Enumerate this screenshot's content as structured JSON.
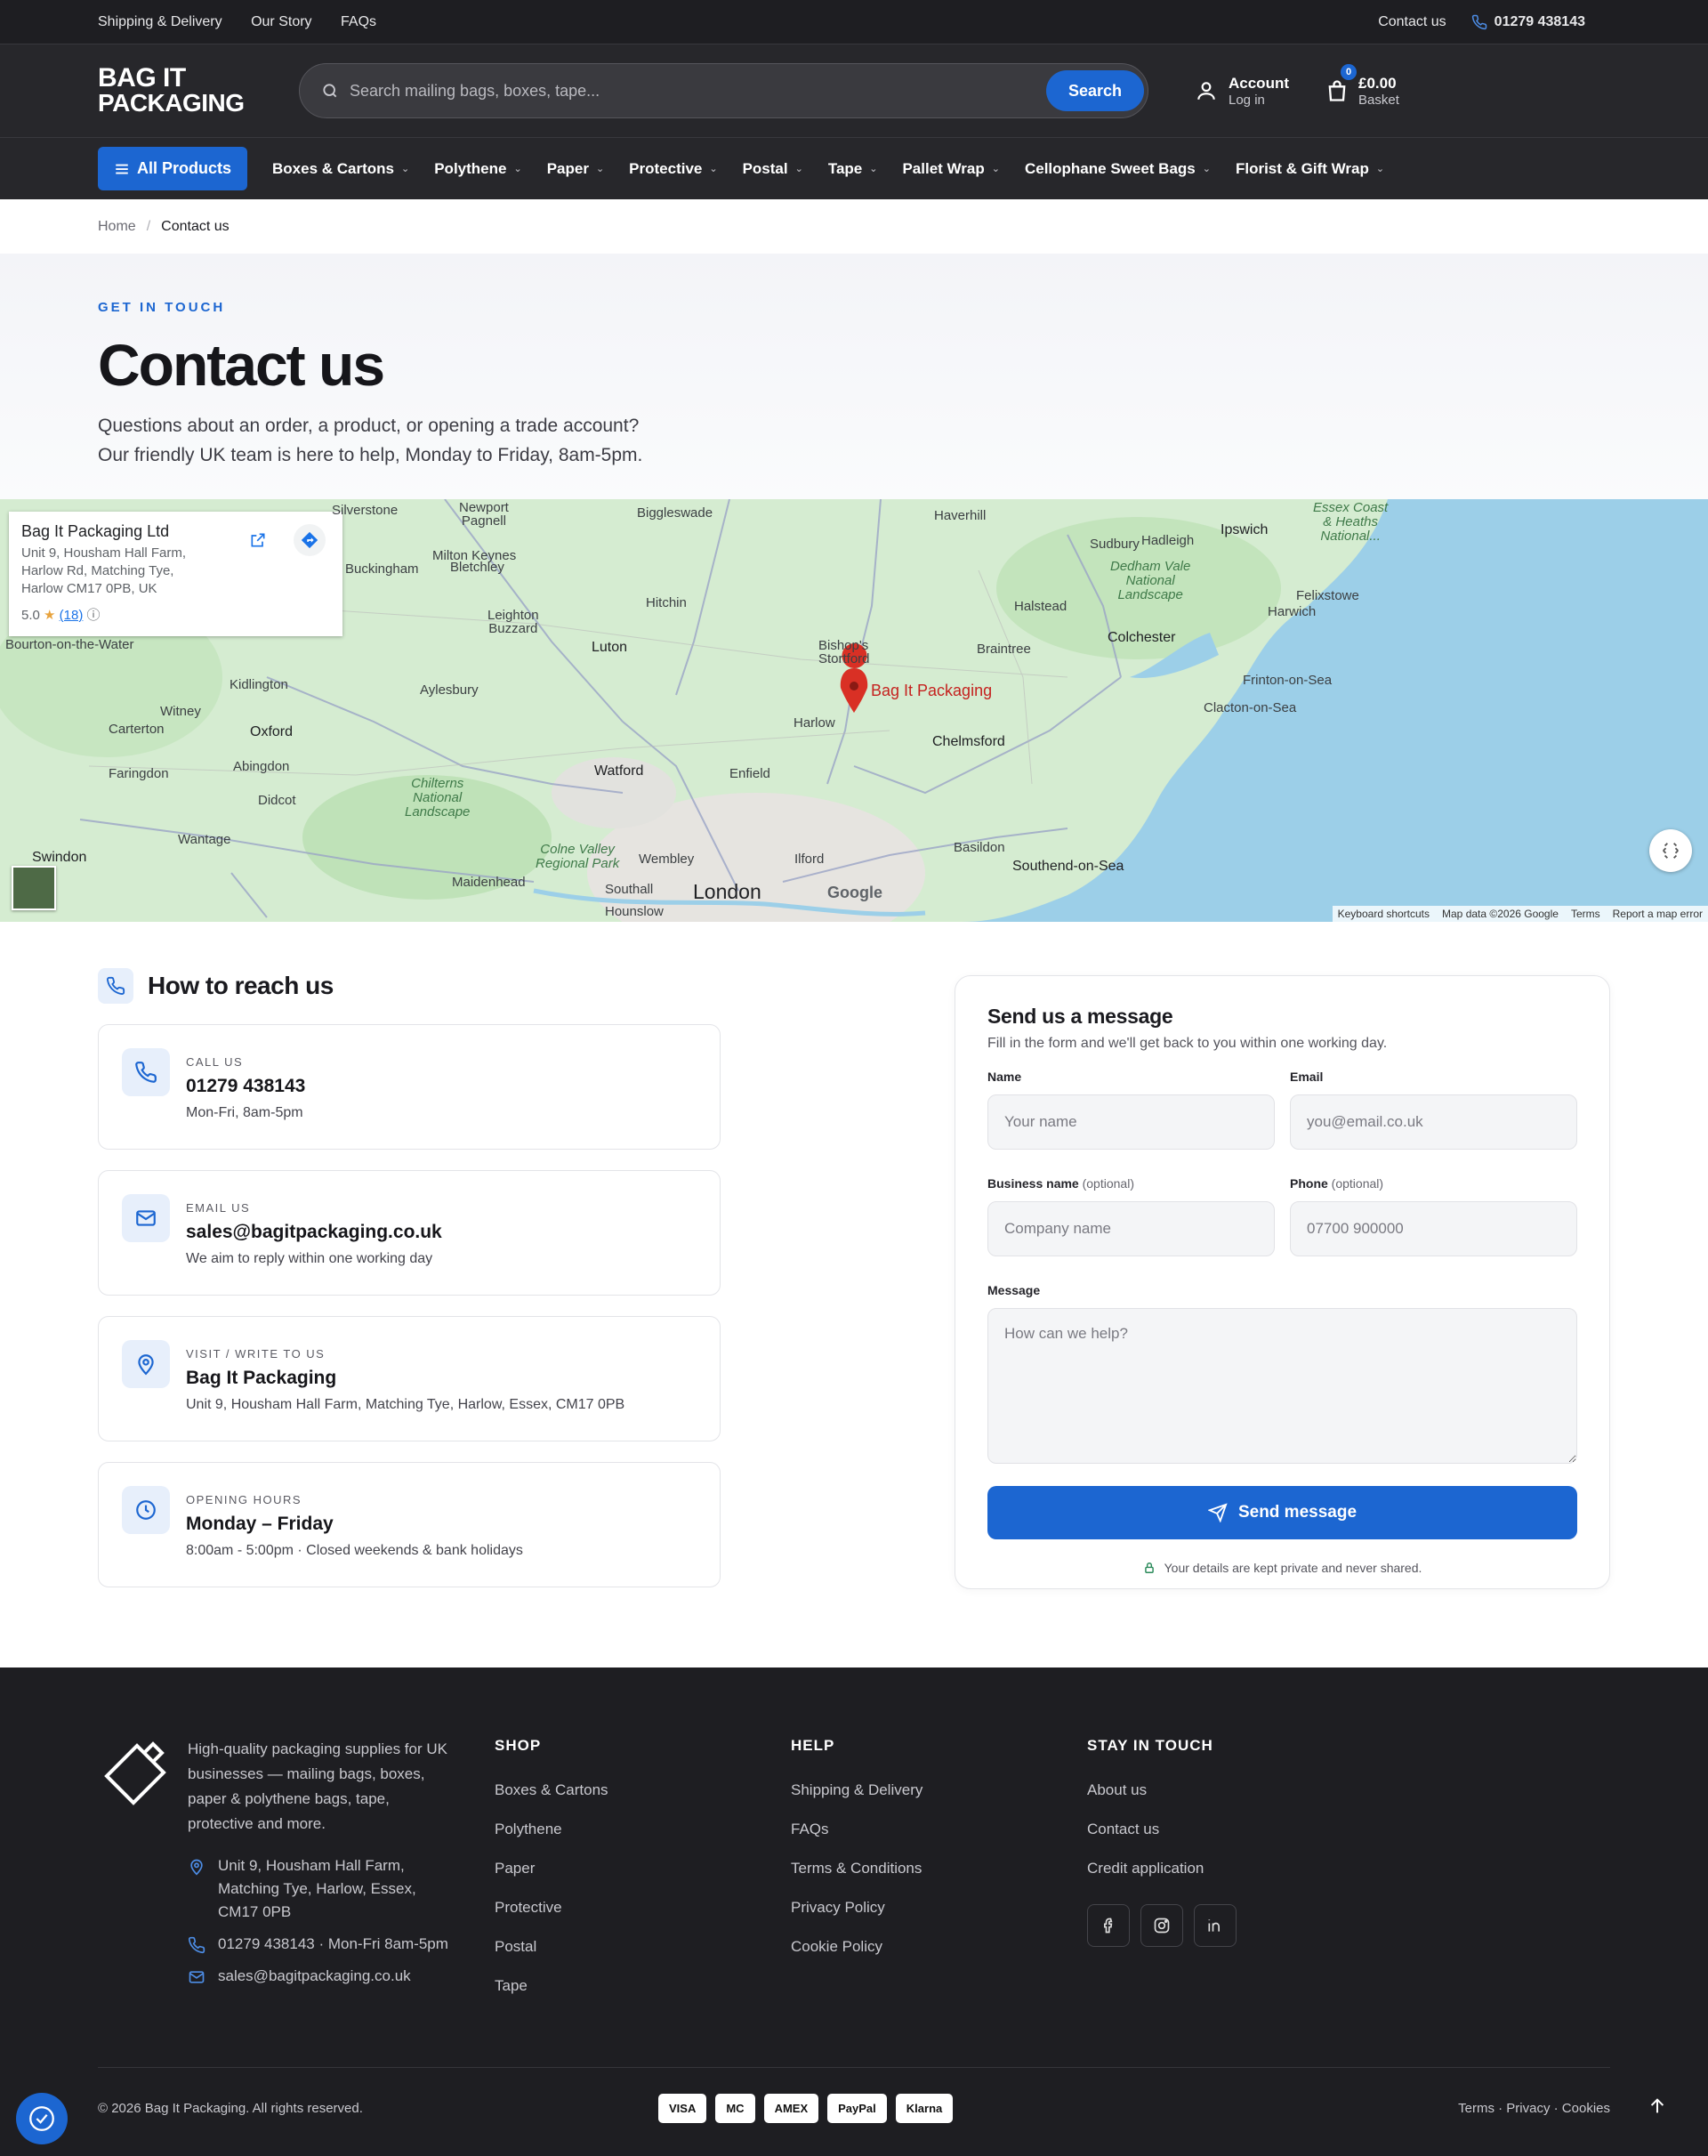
{
  "topbar": {
    "links": [
      "Shipping & Delivery",
      "Our Story",
      "FAQs"
    ],
    "contact_label": "Contact us",
    "phone": "01279 438143"
  },
  "header": {
    "logo_line1": "BAG IT",
    "logo_line2": "PACKAGING",
    "search_placeholder": "Search mailing bags, boxes, tape...",
    "search_button": "Search",
    "account_title": "Account",
    "account_sub": "Log in",
    "basket_count": "0",
    "basket_total": "£0.00",
    "basket_label": "Basket"
  },
  "nav": {
    "all_products": "All Products",
    "items": [
      "Boxes & Cartons",
      "Polythene",
      "Paper",
      "Protective",
      "Postal",
      "Tape",
      "Pallet Wrap",
      "Cellophane Sweet Bags",
      "Florist & Gift Wrap"
    ]
  },
  "breadcrumb": {
    "home": "Home",
    "current": "Contact us"
  },
  "hero": {
    "eyebrow": "GET IN TOUCH",
    "title": "Contact us",
    "line1": "Questions about an order, a product, or opening a trade account?",
    "line2": "Our friendly UK team is here to help, Monday to Friday, 8am-5pm."
  },
  "map": {
    "place_name": "Bag It Packaging Ltd",
    "address_lines": [
      "Unit 9, Housham Hall Farm,",
      "Harlow Rd, Matching Tye,",
      "Harlow CM17 0PB, UK"
    ],
    "rating": "5.0",
    "review_count": "(18)",
    "pin_label": "Bag It Packaging",
    "footer_links": [
      "Keyboard shortcuts",
      "Map data ©2026 Google",
      "Terms",
      "Report a map error"
    ],
    "google": "Google",
    "labels": {
      "london": "London",
      "luton": "Luton",
      "chelmsford": "Chelmsford",
      "colchester": "Colchester",
      "watford": "Watford",
      "oxford": "Oxford",
      "southend": "Southend-on-Sea",
      "ipswich": "Ipswich",
      "harlow": "Harlow",
      "bishops": "Bishop's",
      "stortford": "Stortford",
      "enfield": "Enfield",
      "hitchin": "Hitchin",
      "aylesbury": "Aylesbury",
      "swindon": "Swindon",
      "milton": "Milton Keynes",
      "basildon": "Basildon",
      "braintree": "Braintree",
      "halstead": "Halstead",
      "sudbury": "Sudbury",
      "clacton": "Clacton-on-Sea",
      "frinton": "Frinton-on-Sea",
      "harwich": "Harwich",
      "felixstowe": "Felixstowe",
      "biggleswade": "Biggleswade",
      "haverhill": "Haverhill",
      "hadleigh": "Hadleigh",
      "buckingham": "Buckingham",
      "bletchley": "Bletchley",
      "leighton1": "Leighton",
      "leighton2": "Buzzard",
      "kidlington": "Kidlington",
      "witney": "Witney",
      "carterton": "Carterton",
      "abingdon": "Abingdon",
      "didcot": "Didcot",
      "faringdon": "Faringdon",
      "wantage": "Wantage",
      "maidenhead": "Maidenhead",
      "wembley": "Wembley",
      "southall": "Southall",
      "hounslow": "Hounslow",
      "ilford": "Ilford",
      "newport1": "Newport",
      "newport2": "Pagnell",
      "silverstone": "Silverstone",
      "bourton": "Bourton-on-the-Water",
      "dedham1": "Dedham Vale",
      "dedham2": "National",
      "dedham3": "Landscape",
      "chilterns1": "Chilterns",
      "chilterns2": "National",
      "chilterns3": "Landscape",
      "colne1": "Colne Valley",
      "colne2": "Regional Park",
      "suffolk1": "Essex Coast",
      "suffolk2": "& Heaths",
      "suffolk3": "National..."
    }
  },
  "reach": {
    "title": "How to reach us",
    "cards": [
      {
        "label": "CALL US",
        "value": "01279 438143",
        "sub": "Mon-Fri, 8am-5pm"
      },
      {
        "label": "EMAIL US",
        "value": "sales@bagitpackaging.co.uk",
        "sub": "We aim to reply within one working day"
      },
      {
        "label": "VISIT / WRITE TO US",
        "value": "Bag It Packaging",
        "sub": "Unit 9, Housham Hall Farm, Matching Tye, Harlow, Essex, CM17 0PB"
      },
      {
        "label": "OPENING HOURS",
        "value": "Monday – Friday",
        "sub": "8:00am - 5:00pm · Closed weekends & bank holidays"
      }
    ]
  },
  "form": {
    "title": "Send us a message",
    "subtitle": "Fill in the form and we'll get back to you within one working day.",
    "name_label": "Name",
    "name_placeholder": "Your name",
    "email_label": "Email",
    "email_placeholder": "you@email.co.uk",
    "business_label": "Business name",
    "business_opt": "(optional)",
    "business_placeholder": "Company name",
    "phone_label": "Phone",
    "phone_opt": "(optional)",
    "phone_placeholder": "07700 900000",
    "message_label": "Message",
    "message_placeholder": "How can we help?",
    "submit": "Send message",
    "privacy": "Your details are kept private and never shared."
  },
  "footer": {
    "description": "High-quality packaging supplies for UK businesses — mailing bags, boxes, paper & polythene bags, tape, protective and more.",
    "address": "Unit 9, Housham Hall Farm, Matching Tye, Harlow, Essex, CM17 0PB",
    "phone": "01279 438143 · Mon-Fri 8am-5pm",
    "email": "sales@bagitpackaging.co.uk",
    "shop_title": "SHOP",
    "shop_links": [
      "Boxes & Cartons",
      "Polythene",
      "Paper",
      "Protective",
      "Postal",
      "Tape"
    ],
    "help_title": "HELP",
    "help_links": [
      "Shipping & Delivery",
      "FAQs",
      "Terms & Conditions",
      "Privacy Policy",
      "Cookie Policy"
    ],
    "stay_title": "STAY IN TOUCH",
    "stay_links": [
      "About us",
      "Contact us",
      "Credit application"
    ],
    "copyright": "© 2026 Bag It Packaging. All rights reserved.",
    "payments": [
      "VISA",
      "MC",
      "AMEX",
      "PayPal",
      "Klarna"
    ],
    "legal": "Terms · Privacy · Cookies"
  },
  "colors": {
    "brand_blue": "#1c66d1",
    "dark_bg": "#1e1e22",
    "map_pin": "#d93025"
  }
}
